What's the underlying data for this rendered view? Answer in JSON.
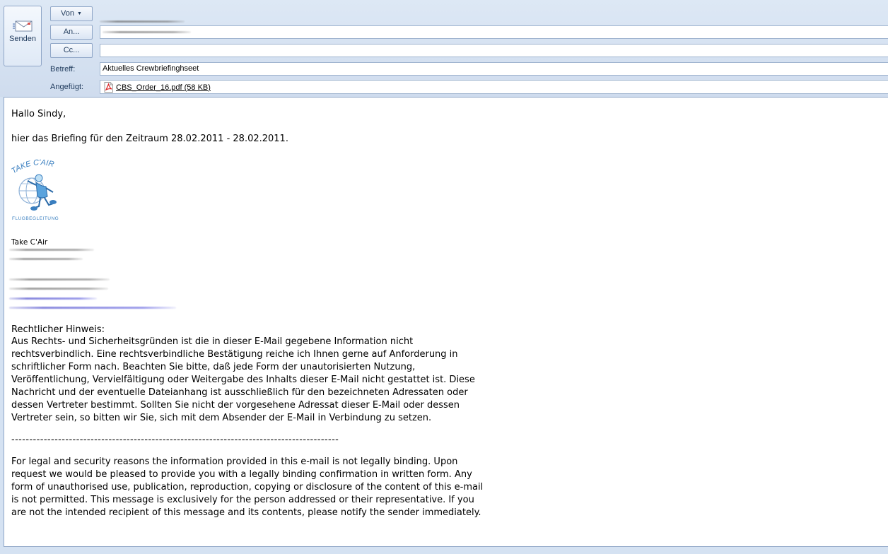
{
  "toolbar": {
    "send_label": "Senden",
    "from_label": "Von",
    "to_label": "An...",
    "cc_label": "Cc...",
    "from_value": "",
    "to_value": "",
    "cc_value": ""
  },
  "fields": {
    "subject_label": "Betreff:",
    "subject_value": "Aktuelles Crewbriefinghseet",
    "attached_label": "Angefügt:",
    "attachment": "CBS_Order_16.pdf (58 KB)"
  },
  "message": {
    "greeting": "Hallo Sindy,",
    "intro": "hier das Briefing für den Zeitraum 28.02.2011 - 28.02.2011.",
    "logo_text_top": "TAKE C'AIR",
    "logo_text_bottom": "FLUGBEGLEITUNG",
    "signature_company": "Take C'Air",
    "legal_title": "Rechtlicher Hinweis:",
    "legal_de": "Aus Rechts- und Sicherheitsgründen ist die in dieser E-Mail gegebene Information nicht\nrechtsverbindlich. Eine rechtsverbindliche Bestätigung reiche ich Ihnen gerne auf Anforderung in\nschriftlicher Form nach. Beachten Sie bitte, daß jede Form der unautorisierten Nutzung,\nVeröffentlichung, Vervielfältigung oder Weitergabe des Inhalts dieser E-Mail nicht gestattet ist. Diese\nNachricht und der eventuelle Dateianhang ist ausschließlich für den bezeichneten Adressaten oder\ndessen Vertreter bestimmt. Sollten Sie nicht der vorgesehene Adressat dieser E-Mail oder dessen\nVertreter sein, so bitten wir Sie, sich mit dem Absender der E-Mail in Verbindung zu setzen.",
    "separator": "-------------------------------------------------------------------------------------------",
    "legal_en": "For legal and security reasons the information provided in this e-mail is not legally binding. Upon\nrequest we would be pleased to provide you with a legally binding confirmation in written form. Any\nform of unauthorised use, publication, reproduction, copying or disclosure of the content of this e-mail\nis not permitted. This message is exclusively for the person addressed or their representative. If you\nare not the intended recipient of this message and its contents, please notify the sender immediately."
  },
  "colors": {
    "chrome": "#d5e2f2",
    "button_border": "#8fa6c7",
    "label_text": "#1e395b",
    "logo_blue": "#3a7fc0"
  },
  "icons": {
    "send": "envelope-send-icon",
    "attachment": "pdf-icon",
    "logo": "take-cair-logo"
  }
}
